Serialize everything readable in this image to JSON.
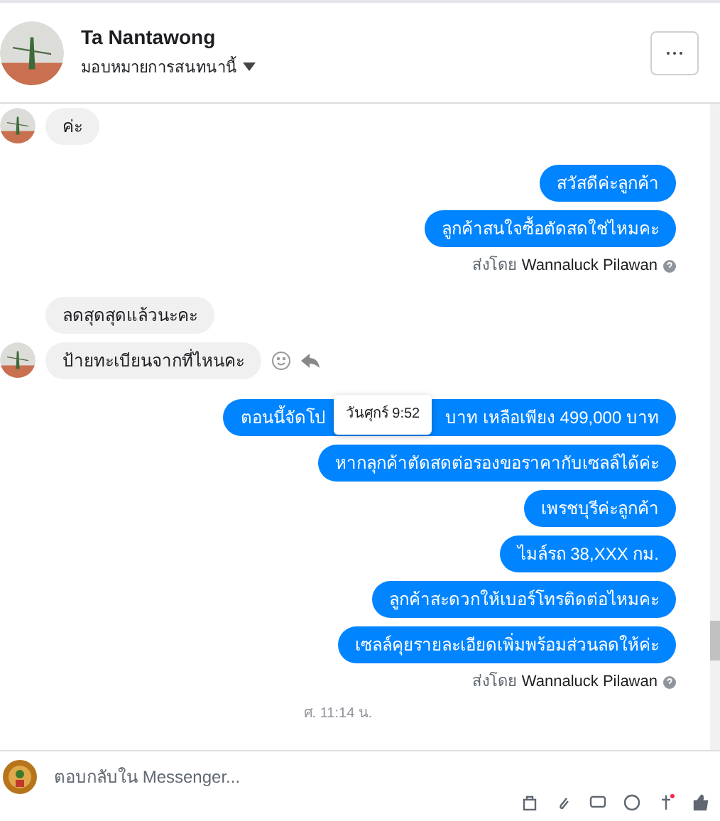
{
  "header": {
    "name": "Ta Nantawong",
    "subtitle": "มอบหมายการสนทนานี้"
  },
  "messages": [
    {
      "kind": "in",
      "text": "ค่ะ",
      "avatar": true,
      "actions": false
    },
    {
      "kind": "out",
      "text": "สวัสดีค่ะลูกค้า"
    },
    {
      "kind": "out",
      "text": "ลูกค้าสนใจซื้อตัดสดใช่ไหมคะ"
    },
    {
      "kind": "sender",
      "prefix": "ส่งโดย",
      "name": "Wannaluck Pilawan"
    },
    {
      "kind": "in",
      "text": "ลดสุดสุดแล้วนะคะ",
      "avatar": false,
      "actions": false
    },
    {
      "kind": "in",
      "text": "ป้ายทะเบียนจากที่ไหนคะ",
      "avatar": true,
      "actions": true
    },
    {
      "kind": "out",
      "text": "ตอนนี้จัดโป",
      "text_after": "บาท  เหลือเพียง 499,000 บาท",
      "tooltip": "วันศุกร์ 9:52"
    },
    {
      "kind": "out",
      "text": "หากลุกค้าตัดสดต่อรองขอราคากับเซลล์ได้ค่ะ"
    },
    {
      "kind": "out",
      "text": "เพรชบุรีค่ะลูกค้า"
    },
    {
      "kind": "out",
      "text": "ไมล์รถ  38,XXX   กม."
    },
    {
      "kind": "out",
      "text": "ลูกค้าสะดวกให้เบอร์โทรติดต่อไหมคะ"
    },
    {
      "kind": "out",
      "text": "เซลล์คุยรายละเอียดเพิ่มพร้อมส่วนลดให้ค่ะ"
    },
    {
      "kind": "sender",
      "prefix": "ส่งโดย",
      "name": "Wannaluck Pilawan"
    },
    {
      "kind": "timestamp",
      "text": "ศ. 11:14 น."
    }
  ],
  "composer": {
    "placeholder": "ตอบกลับใน Messenger..."
  }
}
